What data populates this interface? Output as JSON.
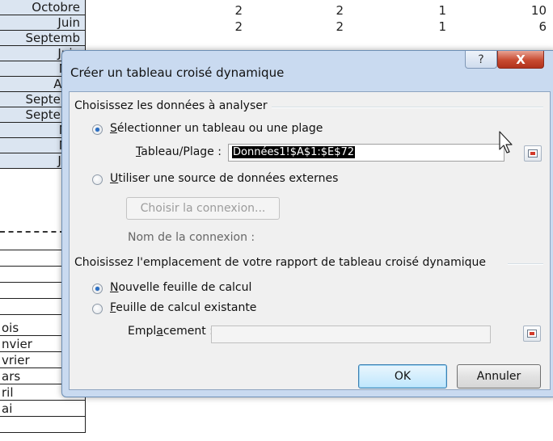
{
  "sheet": {
    "months_top": [
      "Octobre",
      "Juin",
      "Septemb",
      "Juin",
      "Mai",
      "Avril",
      "Septemb",
      "Septemb",
      "Mai",
      "Mai",
      "Juin"
    ],
    "rows": [
      {
        "c1": "2",
        "c2": "2",
        "c3": "1",
        "c4": "10"
      },
      {
        "c1": "2",
        "c2": "2",
        "c3": "1",
        "c4": "6"
      }
    ],
    "months_bottom": [
      "ois",
      "nvier",
      "vrier",
      "ars",
      "ril",
      "ai"
    ]
  },
  "dialog": {
    "title": "Créer un tableau croisé dynamique",
    "help_symbol": "?",
    "close_symbol": "X",
    "section_data": "Choisissez les données à analyser",
    "radio_table": {
      "mnemonic": "S",
      "rest": "électionner un tableau ou une plage",
      "checked": true
    },
    "range_label": {
      "mnemonic": "T",
      "rest": "ableau/Plage :"
    },
    "range_value": "Données1!$A$1:$E$72",
    "radio_external": {
      "mnemonic": "U",
      "rest": "tiliser une source de données externes",
      "checked": false
    },
    "choose_connection": "Choisir la connexion...",
    "connection_name": "Nom de la connexion :",
    "section_location": "Choisissez l'emplacement de votre rapport de tableau croisé dynamique",
    "radio_new_sheet": {
      "mnemonic": "N",
      "rest": "ouvelle feuille de calcul",
      "checked": true
    },
    "radio_existing_sheet": {
      "mnemonic": "F",
      "rest": "euille de calcul existante",
      "checked": false
    },
    "location_label": {
      "before": "Empl",
      "mnemonic": "a",
      "after": "cement :"
    },
    "location_value": "",
    "ok": "OK",
    "cancel": "Annuler"
  },
  "icons": [
    "range-selector-icon",
    "close-icon",
    "help-icon",
    "mouse-pointer-icon"
  ],
  "colors": {
    "title_bar": "#c9daf0",
    "close_button": "#c84a31",
    "selection_fill": "#dbe5f1"
  }
}
